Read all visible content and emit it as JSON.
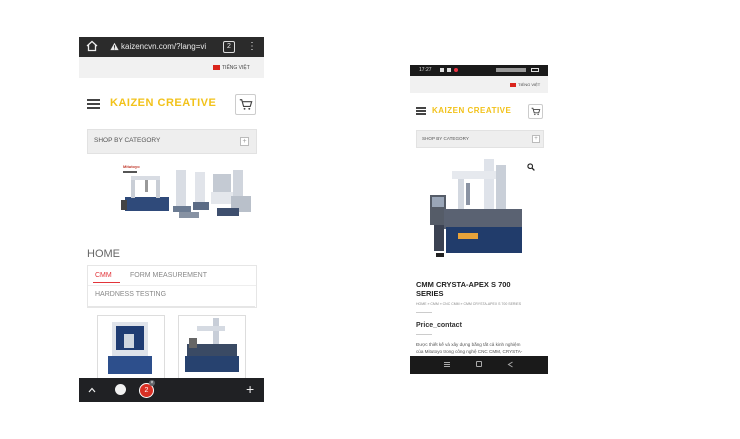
{
  "left_phone": {
    "browser": {
      "url": "kaizencvn.com/?lang=vi",
      "tab_count": "2"
    },
    "language": "TIẾNG VIỆT",
    "logo": "KAIZEN CREATIVE",
    "shop_by_category": "SHOP BY CATEGORY",
    "banner_brand": "Mitutoyo",
    "section_title": "HOME",
    "tabs": [
      {
        "label": "CMM",
        "active": true
      },
      {
        "label": "FORM MEASUREMENT",
        "active": false
      },
      {
        "label": "HARDNESS TESTING",
        "active": false
      }
    ],
    "nav_badge": "2"
  },
  "right_phone": {
    "status_time": "17:27",
    "language": "TIẾNG VIỆT",
    "logo": "KAIZEN CREATIVE",
    "shop_by_category": "SHOP BY CATEGORY",
    "product_title_line1": "CMM CRYSTA-APEX S 700",
    "product_title_line2": "SERIES",
    "breadcrumb": "HOME » CMM » CNC CMM » CMM CRYSTA-APEX S 700 SERIES",
    "price": "Price_contact",
    "description_line1": "Được thiết kế và xây dựng bằng tất cả kinh nghiệm",
    "description_line2": "của Mitutoyo trong công nghệ CNC CMM, CRYSTA-"
  },
  "colors": {
    "logo_yellow": "#f2c21a",
    "active_tab_red": "#e2343a",
    "browser_bar": "#2b2b2b",
    "nav_bar": "#202124"
  }
}
